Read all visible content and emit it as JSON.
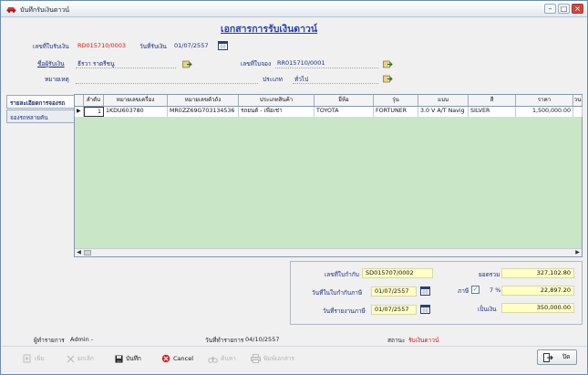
{
  "window": {
    "title": "บันทึกรับเงินดาวน์"
  },
  "document_title": "เอกสารการรับเงินดาวน์",
  "header": {
    "receipt_no_label": "เลขที่ใบรับเงิน",
    "receipt_no_value": "RD015710/0003",
    "receipt_date_label": "วันที่รับเงิน",
    "receipt_date_value": "01/07/2557",
    "receiver_label": "ชื่อผู้รับเงิน",
    "receiver_value": "ธีรวา ราตรีชนู",
    "booking_no_label": "เลขที่ใบจอง",
    "booking_no_value": "RR015710/0001",
    "remark_label": "หมายเหตุ",
    "remark_value": "",
    "type_label": "ประเภท",
    "type_value": "ทั่วไป"
  },
  "tabs": [
    {
      "label": "รายละเอียดการจองรถ",
      "active": true
    },
    {
      "label": "จองรถหลายคัน",
      "active": false
    }
  ],
  "grid": {
    "columns": [
      "ลำดับ",
      "หมายเลขเครื่อง",
      "หมายเลขตัวถัง",
      "ประเภทสินค้า",
      "ยี่ห้อ",
      "รุ่น",
      "แบบ",
      "สี",
      "ราคา",
      "วน"
    ],
    "rows": [
      [
        "1",
        "1KDU603780",
        "MR0ZZ69G703134536",
        "รถยนต์ - เพื่อเช่า",
        "TOYOTA",
        "FORTUNER",
        "3.0 V A/T Navig",
        "SILVER",
        "1,500,000.00",
        ""
      ]
    ]
  },
  "summary": {
    "invoice_no_label": "เลขที่ใบกำกับ",
    "invoice_no_value": "SD015707/0002",
    "invoice_date_label": "วันที่ในใบกำกับภาษี",
    "invoice_date_value": "01/07/2557",
    "report_date_label": "วันที่รายงานภาษี",
    "report_date_value": "01/07/2557",
    "subtotal_label": "ยอดรวม",
    "subtotal_value": "327,102.80",
    "vat_label": "ภาษี",
    "vat_checked": true,
    "vat_rate": "7 %",
    "vat_value": "22,897.20",
    "total_label": "เป็นเงิน",
    "total_value": "350,000.00"
  },
  "status": {
    "operator_label": "ผู้ทำรายการ",
    "operator_value": "Admin -",
    "op_date_label": "วันที่ทำรายการ",
    "op_date_value": "04/10/2557",
    "state_label": "สถานะ",
    "state_value": "รับเงินดาวน์"
  },
  "toolbar": {
    "add": "เพิ่ม",
    "cancel_doc": "ยกเลิก",
    "save": "บันทึก",
    "cancel": "Cancel",
    "search": "ค้นหา",
    "print": "พิมพ์เอกสาร",
    "close": "ปิด"
  },
  "colors": {
    "title_blue": "#2b3fb0",
    "value_red": "#dd1111",
    "grid_bg": "#c9e6c6",
    "input_yellow": "#ffffc4"
  }
}
